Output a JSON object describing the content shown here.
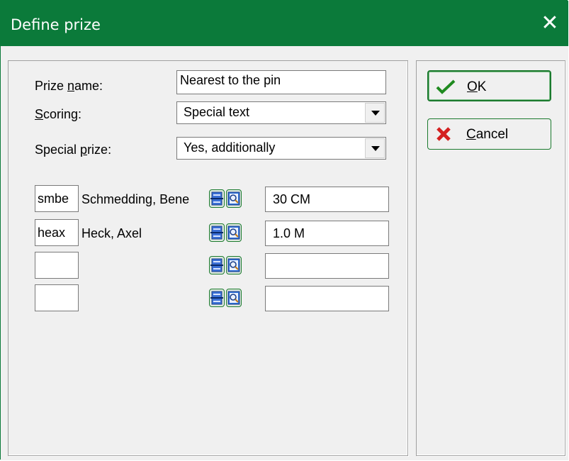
{
  "window": {
    "title": "Define prize",
    "close_glyph": "✕",
    "accent_color": "#0b7a3a"
  },
  "form": {
    "prize_name": {
      "label_pre": "Prize ",
      "label_mnemonic": "n",
      "label_post": "ame:",
      "value": "Nearest to the pin"
    },
    "scoring": {
      "label_pre": "",
      "label_mnemonic": "S",
      "label_post": "coring:",
      "value": "Special text"
    },
    "special_prize": {
      "label_pre": "Special ",
      "label_mnemonic": "p",
      "label_post": "rize:",
      "value": "Yes, additionally"
    }
  },
  "rows": [
    {
      "code": "smbe",
      "name": "Schmedding, Bene",
      "result": "30 CM"
    },
    {
      "code": "heax",
      "name": "Heck, Axel",
      "result": "1.0 M"
    },
    {
      "code": "",
      "name": "",
      "result": ""
    },
    {
      "code": "",
      "name": "",
      "result": ""
    }
  ],
  "buttons": {
    "ok": {
      "label_pre": "",
      "label_mnemonic": "O",
      "label_post": "K",
      "icon": "checkmark-icon"
    },
    "cancel": {
      "label_pre": "",
      "label_mnemonic": "C",
      "label_post": "ancel",
      "icon": "red-x-icon"
    }
  },
  "row_icons": [
    "list-select-icon",
    "magnifier-search-icon"
  ]
}
